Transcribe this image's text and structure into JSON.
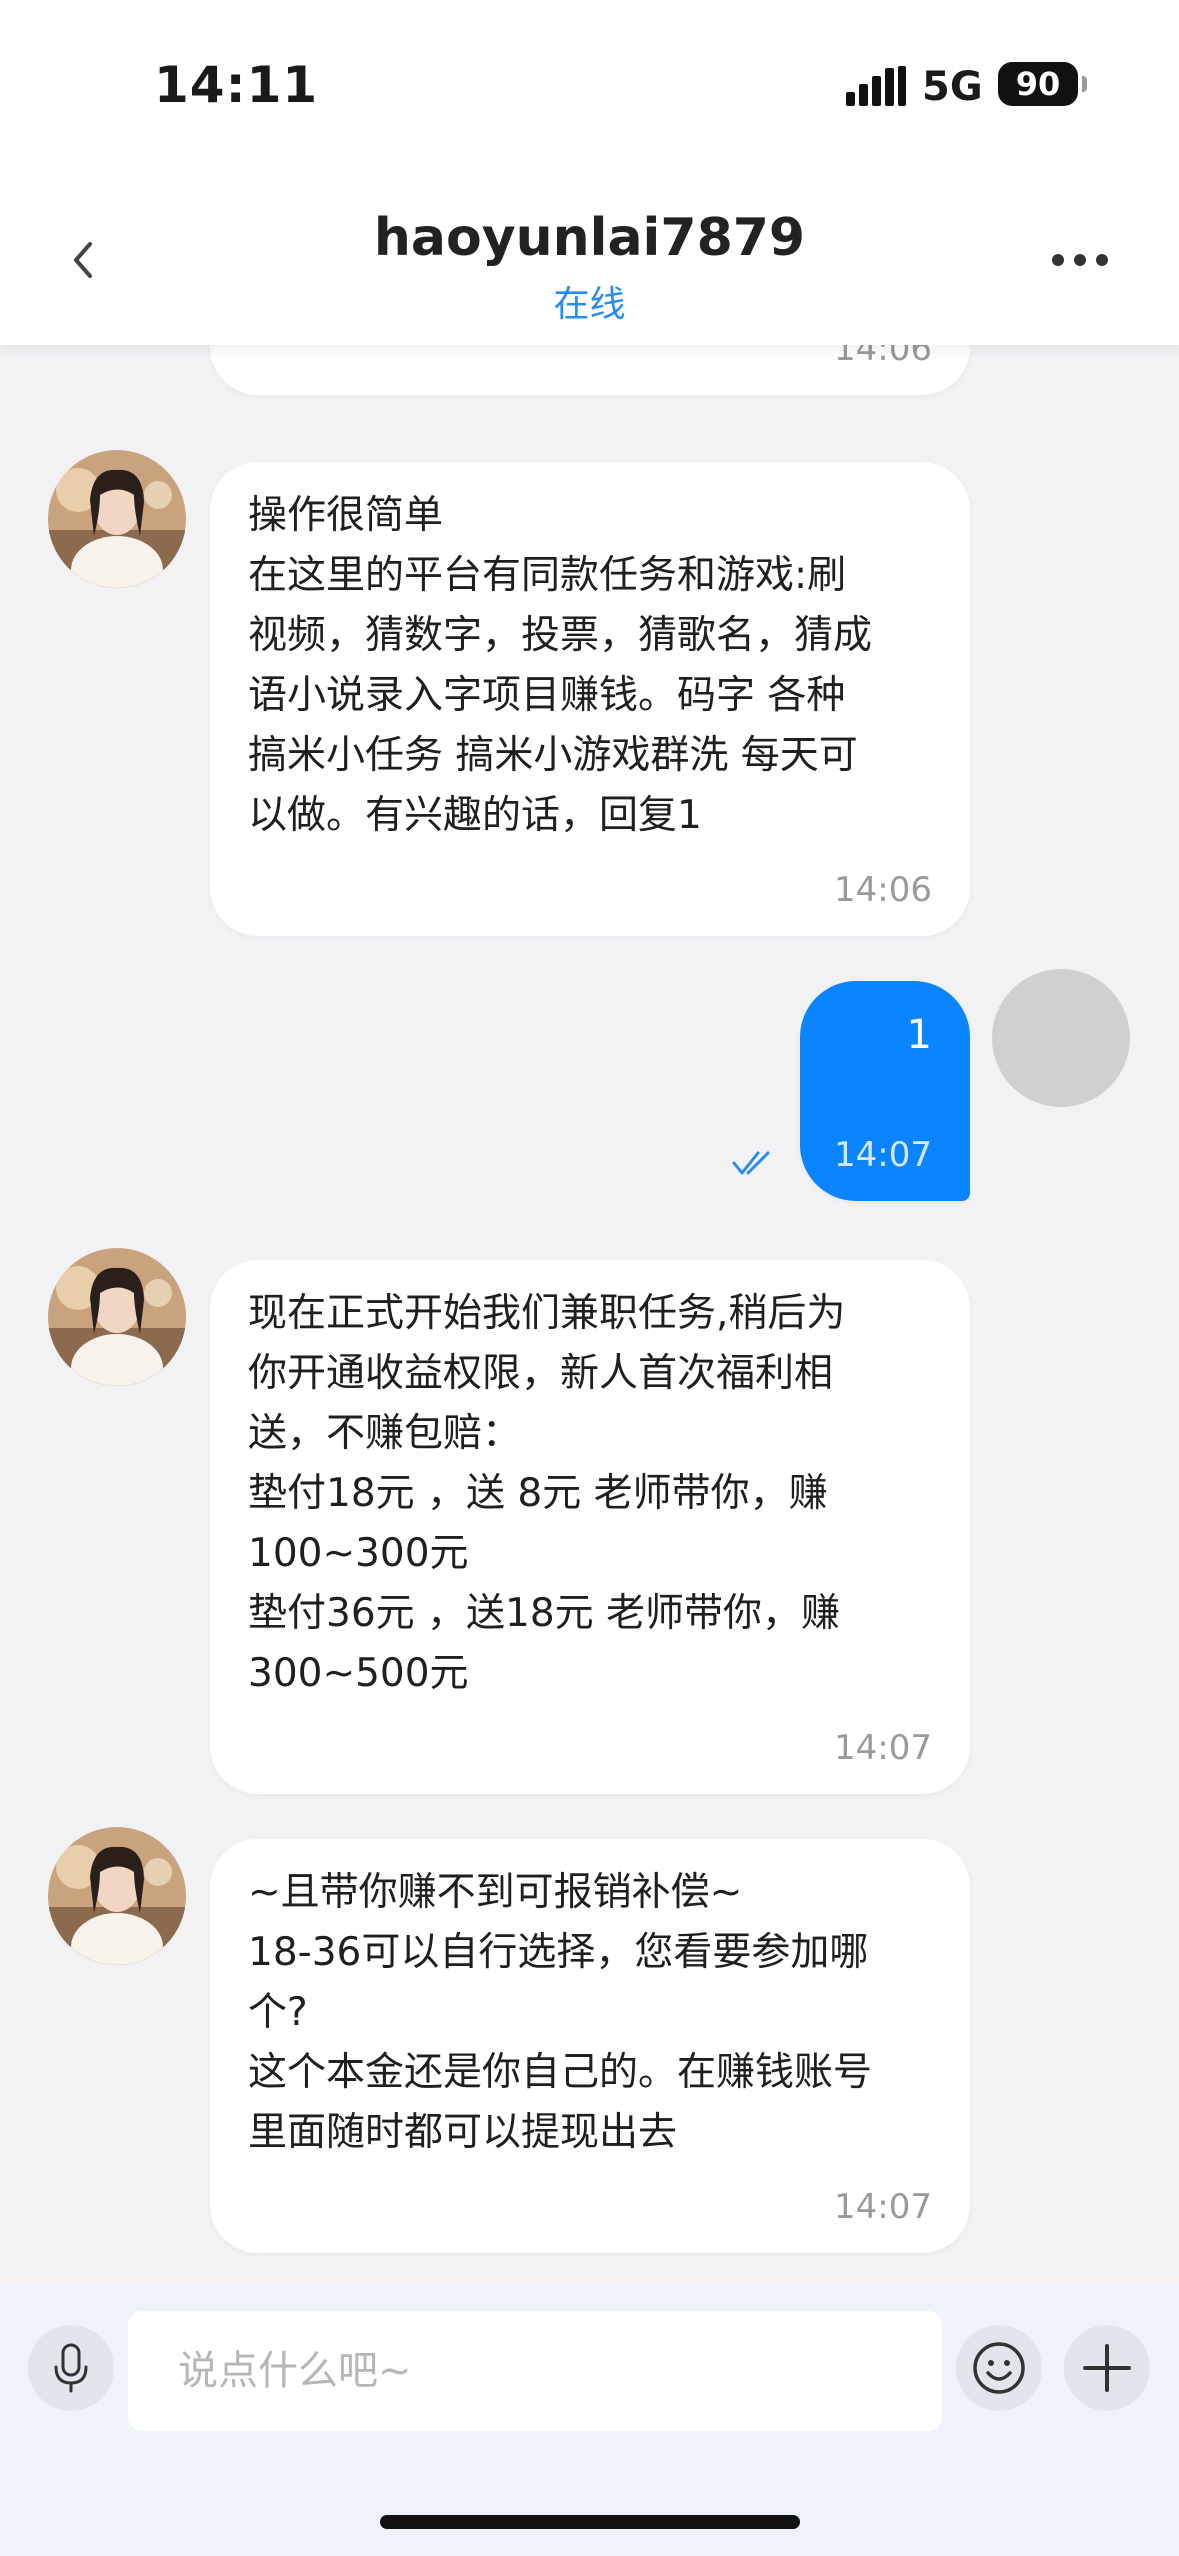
{
  "status_bar": {
    "time": "14:11",
    "network": "5G",
    "battery": "90"
  },
  "header": {
    "title": "haoyunlai7879",
    "status": "在线"
  },
  "messages": [
    {
      "direction": "incoming",
      "text": "",
      "time": "14:06"
    },
    {
      "direction": "incoming",
      "text": "操作很简单\n在这里的平台有同款任务和游戏:刷\n视频，猜数字，投票，猜歌名，猜成\n语小说录入字项目赚钱。码字 各种\n搞米小任务 搞米小游戏群洗 每天可\n以做。有兴趣的话，回复1",
      "time": "14:06"
    },
    {
      "direction": "outgoing",
      "text": "1",
      "time": "14:07"
    },
    {
      "direction": "incoming",
      "text": "现在正式开始我们兼职任务,稍后为\n你开通收益权限，新人首次福利相\n送，不赚包赔：\n垫付18元 ，送 8元 老师带你，赚\n100~300元\n垫付36元 ，送18元 老师带你，赚\n300~500元",
      "time": "14:07"
    },
    {
      "direction": "incoming",
      "text": "~且带你赚不到可报销补偿~\n18-36可以自行选择，您看要参加哪\n个?\n这个本金还是你自己的。在赚钱账号\n里面随时都可以提现出去",
      "time": "14:07"
    }
  ],
  "input": {
    "placeholder": "说点什么吧~",
    "value": ""
  },
  "icons": {
    "back": "chevron-left-icon",
    "more": "more-dots-icon",
    "mic": "microphone-icon",
    "emoji": "emoji-icon",
    "add": "plus-icon",
    "read": "double-check-icon"
  },
  "colors": {
    "accent": "#0a84ff",
    "online": "#2a8cf0",
    "background": "#f2f2f5"
  }
}
